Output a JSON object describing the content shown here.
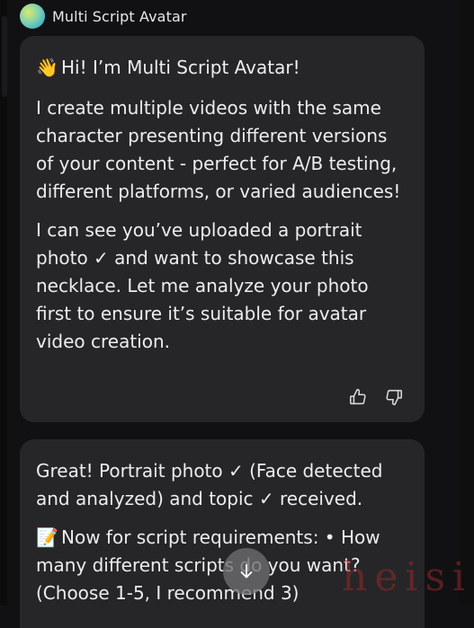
{
  "header": {
    "assistant_name": "Multi Script Avatar",
    "avatar_icon": "gradient-orb-avatar"
  },
  "messages": [
    {
      "greeting_emoji": "👋",
      "greeting_text": "Hi! I’m Multi Script Avatar!",
      "paragraph_1": "I create multiple videos with the same character presenting different versions of your content - perfect for A/B testing, different platforms, or varied audiences!",
      "paragraph_2": "I can see you’ve uploaded a portrait photo ✓ and want to showcase this necklace. Let me analyze your photo first to ensure it’s suitable for avatar video creation.",
      "actions": {
        "like_icon": "thumbs-up-icon",
        "dislike_icon": "thumbs-down-icon"
      }
    },
    {
      "paragraph_1": "Great! Portrait photo ✓ (Face detected and analyzed) and topic ✓ received.",
      "memo_emoji": "📝",
      "paragraph_2_text": "Now for script requirements: • How many different scripts do you want? (Choose 1-5, I recommend 3)"
    }
  ],
  "scroll_button": {
    "icon": "arrow-down-icon"
  },
  "watermark": "heisi",
  "colors": {
    "background": "#111113",
    "bubble": "#262628",
    "text": "#ededee",
    "scroll_button": "#6e6e72"
  }
}
